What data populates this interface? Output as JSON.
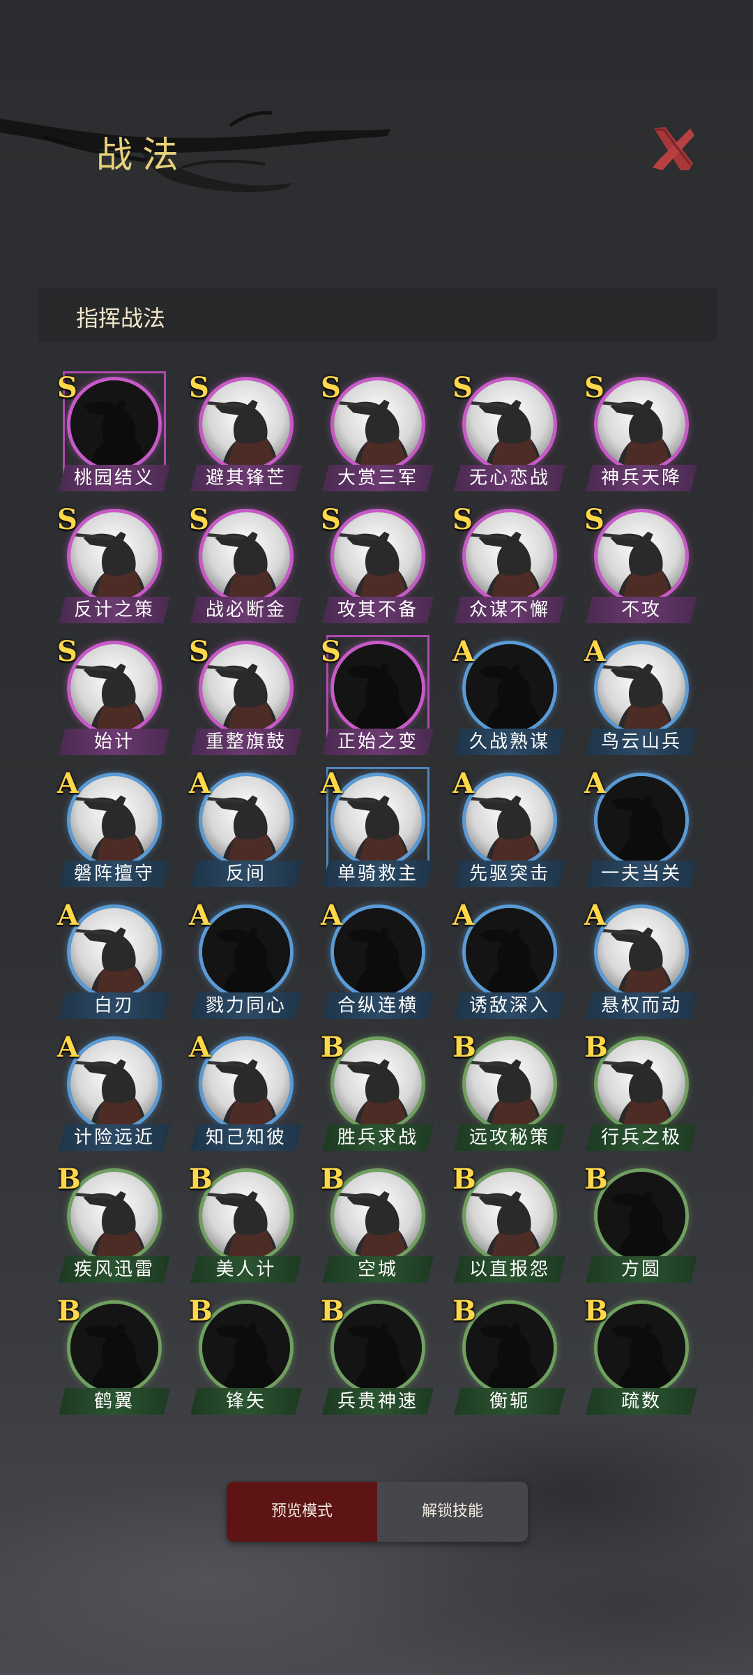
{
  "header": {
    "title": "战法",
    "close_icon": "close-x-icon"
  },
  "section": {
    "title": "指挥战法"
  },
  "colors": {
    "S": "#c85ac8",
    "A": "#5a9bd6",
    "B": "#6fa060",
    "grade_text": "#ffd84a",
    "active_tab": "#5e1414"
  },
  "skills": [
    {
      "name": "桃园结义",
      "grade": "S",
      "locked": true,
      "framed": true
    },
    {
      "name": "避其锋芒",
      "grade": "S",
      "locked": false,
      "framed": false
    },
    {
      "name": "大赏三军",
      "grade": "S",
      "locked": false,
      "framed": false
    },
    {
      "name": "无心恋战",
      "grade": "S",
      "locked": false,
      "framed": false
    },
    {
      "name": "神兵天降",
      "grade": "S",
      "locked": false,
      "framed": false
    },
    {
      "name": "反计之策",
      "grade": "S",
      "locked": false,
      "framed": false
    },
    {
      "name": "战必断金",
      "grade": "S",
      "locked": false,
      "framed": false
    },
    {
      "name": "攻其不备",
      "grade": "S",
      "locked": false,
      "framed": false
    },
    {
      "name": "众谋不懈",
      "grade": "S",
      "locked": false,
      "framed": false
    },
    {
      "name": "不攻",
      "grade": "S",
      "locked": false,
      "framed": false
    },
    {
      "name": "始计",
      "grade": "S",
      "locked": false,
      "framed": false
    },
    {
      "name": "重整旗鼓",
      "grade": "S",
      "locked": false,
      "framed": false
    },
    {
      "name": "正始之变",
      "grade": "S",
      "locked": true,
      "framed": true
    },
    {
      "name": "久战熟谋",
      "grade": "A",
      "locked": true,
      "framed": false
    },
    {
      "name": "鸟云山兵",
      "grade": "A",
      "locked": false,
      "framed": false
    },
    {
      "name": "磐阵擅守",
      "grade": "A",
      "locked": false,
      "framed": false
    },
    {
      "name": "反间",
      "grade": "A",
      "locked": false,
      "framed": false
    },
    {
      "name": "单骑救主",
      "grade": "A",
      "locked": false,
      "framed": true
    },
    {
      "name": "先驱突击",
      "grade": "A",
      "locked": false,
      "framed": false
    },
    {
      "name": "一夫当关",
      "grade": "A",
      "locked": true,
      "framed": false
    },
    {
      "name": "白刃",
      "grade": "A",
      "locked": false,
      "framed": false
    },
    {
      "name": "戮力同心",
      "grade": "A",
      "locked": true,
      "framed": false
    },
    {
      "name": "合纵连横",
      "grade": "A",
      "locked": true,
      "framed": false
    },
    {
      "name": "诱敌深入",
      "grade": "A",
      "locked": true,
      "framed": false
    },
    {
      "name": "悬权而动",
      "grade": "A",
      "locked": false,
      "framed": false
    },
    {
      "name": "计险远近",
      "grade": "A",
      "locked": false,
      "framed": false
    },
    {
      "name": "知己知彼",
      "grade": "A",
      "locked": false,
      "framed": false
    },
    {
      "name": "胜兵求战",
      "grade": "B",
      "locked": false,
      "framed": false
    },
    {
      "name": "远攻秘策",
      "grade": "B",
      "locked": false,
      "framed": false
    },
    {
      "name": "行兵之极",
      "grade": "B",
      "locked": false,
      "framed": false
    },
    {
      "name": "疾风迅雷",
      "grade": "B",
      "locked": false,
      "framed": false
    },
    {
      "name": "美人计",
      "grade": "B",
      "locked": false,
      "framed": false
    },
    {
      "name": "空城",
      "grade": "B",
      "locked": false,
      "framed": false
    },
    {
      "name": "以直报怨",
      "grade": "B",
      "locked": false,
      "framed": false
    },
    {
      "name": "方圆",
      "grade": "B",
      "locked": true,
      "framed": false
    },
    {
      "name": "鹤翼",
      "grade": "B",
      "locked": true,
      "framed": false
    },
    {
      "name": "锋矢",
      "grade": "B",
      "locked": true,
      "framed": false
    },
    {
      "name": "兵贵神速",
      "grade": "B",
      "locked": true,
      "framed": false
    },
    {
      "name": "衡轭",
      "grade": "B",
      "locked": true,
      "framed": false
    },
    {
      "name": "疏数",
      "grade": "B",
      "locked": true,
      "framed": false
    }
  ],
  "footer": {
    "preview_label": "预览模式",
    "unlock_label": "解锁技能"
  }
}
